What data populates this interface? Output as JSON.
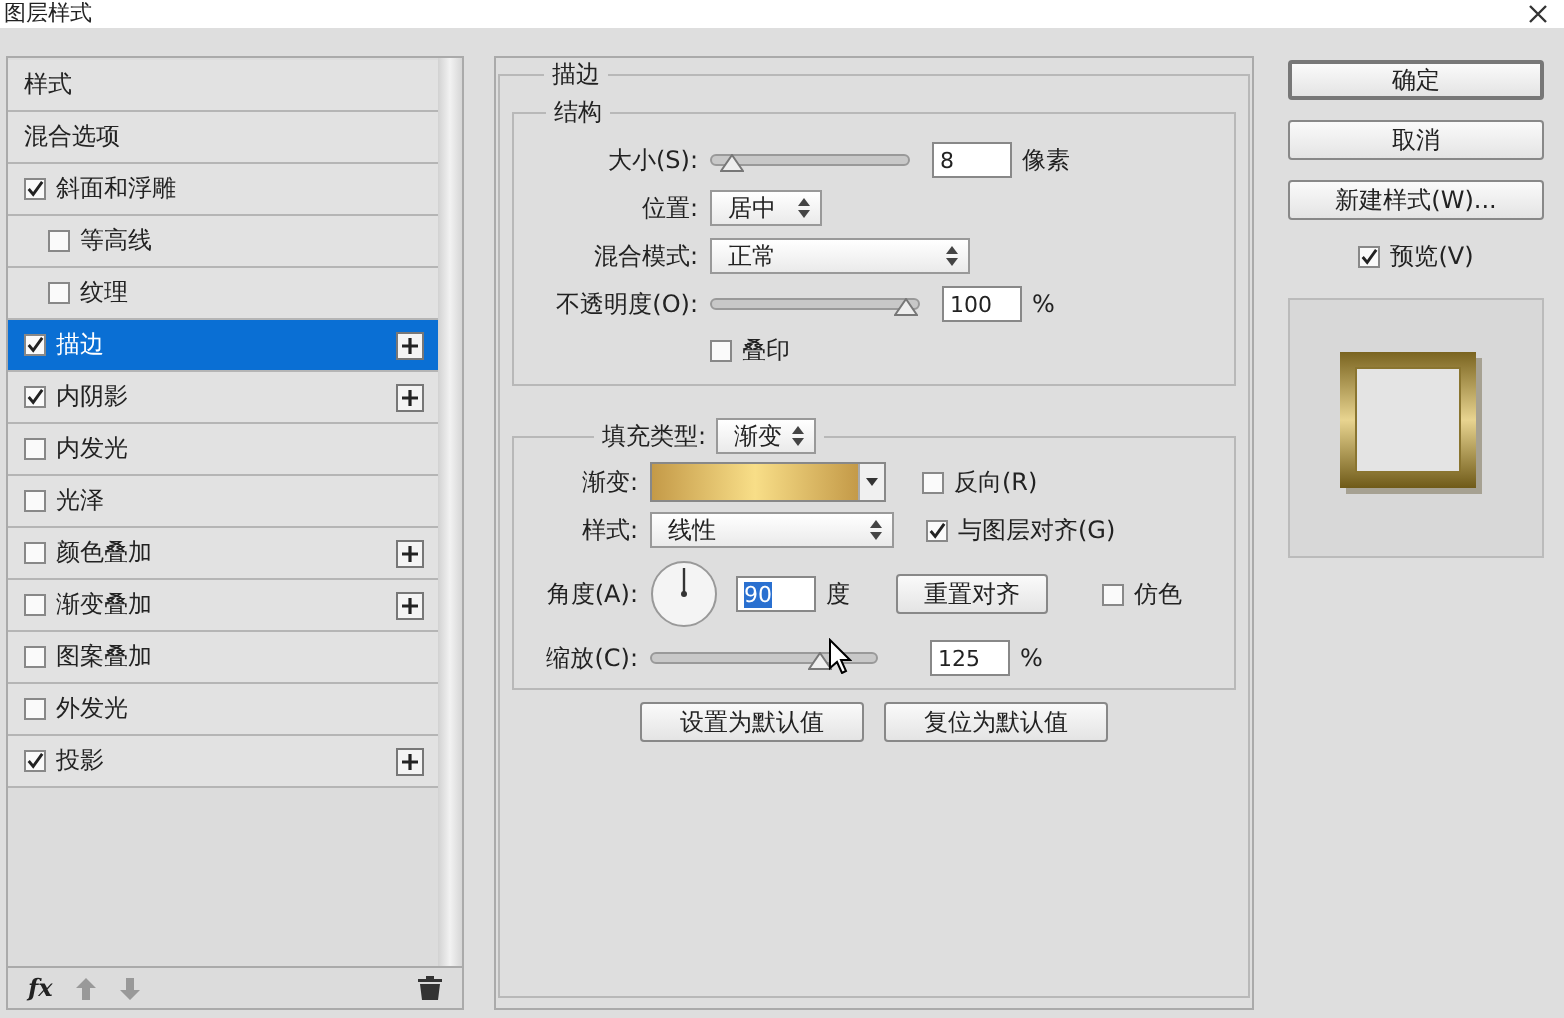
{
  "window": {
    "title": "图层样式"
  },
  "sidebar": {
    "items": [
      {
        "label": "样式",
        "kind": "header",
        "selected": false
      },
      {
        "label": "混合选项",
        "kind": "header",
        "selected": false
      },
      {
        "label": "斜面和浮雕",
        "kind": "effect",
        "checked": true,
        "selected": false,
        "add_button": false,
        "children": [
          {
            "label": "等高线",
            "kind": "effect",
            "checked": false,
            "selected": false,
            "add_button": false
          },
          {
            "label": "纹理",
            "kind": "effect",
            "checked": false,
            "selected": false,
            "add_button": false
          }
        ]
      },
      {
        "label": "描边",
        "kind": "effect",
        "checked": true,
        "selected": true,
        "add_button": true
      },
      {
        "label": "内阴影",
        "kind": "effect",
        "checked": true,
        "selected": false,
        "add_button": true
      },
      {
        "label": "内发光",
        "kind": "effect",
        "checked": false,
        "selected": false,
        "add_button": false
      },
      {
        "label": "光泽",
        "kind": "effect",
        "checked": false,
        "selected": false,
        "add_button": false
      },
      {
        "label": "颜色叠加",
        "kind": "effect",
        "checked": false,
        "selected": false,
        "add_button": true
      },
      {
        "label": "渐变叠加",
        "kind": "effect",
        "checked": false,
        "selected": false,
        "add_button": true
      },
      {
        "label": "图案叠加",
        "kind": "effect",
        "checked": false,
        "selected": false,
        "add_button": false
      },
      {
        "label": "外发光",
        "kind": "effect",
        "checked": false,
        "selected": false,
        "add_button": false
      },
      {
        "label": "投影",
        "kind": "effect",
        "checked": true,
        "selected": false,
        "add_button": true
      }
    ],
    "fx_label": "fx"
  },
  "stroke": {
    "title": "描边",
    "structure": {
      "title": "结构",
      "size": {
        "label": "大小(S):",
        "level": 0.05,
        "value": "8",
        "unit": "像素"
      },
      "position": {
        "label": "位置:",
        "value": "居中"
      },
      "blend_mode": {
        "label": "混合模式:",
        "value": "正常"
      },
      "opacity": {
        "label": "不透明度(O):",
        "level": 1,
        "value": "100",
        "unit": "%"
      },
      "overprint": {
        "label": "叠印",
        "checked": false
      }
    },
    "fill": {
      "fill_type": {
        "label": "填充类型:",
        "value": "渐变"
      },
      "gradient": {
        "label": "渐变:"
      },
      "reverse": {
        "label": "反向(R)",
        "checked": false
      },
      "style": {
        "label": "样式:",
        "value": "线性"
      },
      "align": {
        "label": "与图层对齐(G)",
        "checked": true
      },
      "angle": {
        "label": "角度(A):",
        "value": "90",
        "text_selected": true,
        "unit": "度"
      },
      "reset_button": "重置对齐",
      "dither": {
        "label": "仿色",
        "checked": false
      },
      "scale": {
        "label": "缩放(C):",
        "level": 0.78,
        "value": "125",
        "unit": "%"
      }
    },
    "buttons": [
      "设置为默认值",
      "复位为默认值"
    ]
  },
  "actions": {
    "buttons": [
      "确定",
      "取消",
      "新建样式(W)..."
    ],
    "preview": {
      "label": "预览(V)",
      "checked": true
    }
  }
}
